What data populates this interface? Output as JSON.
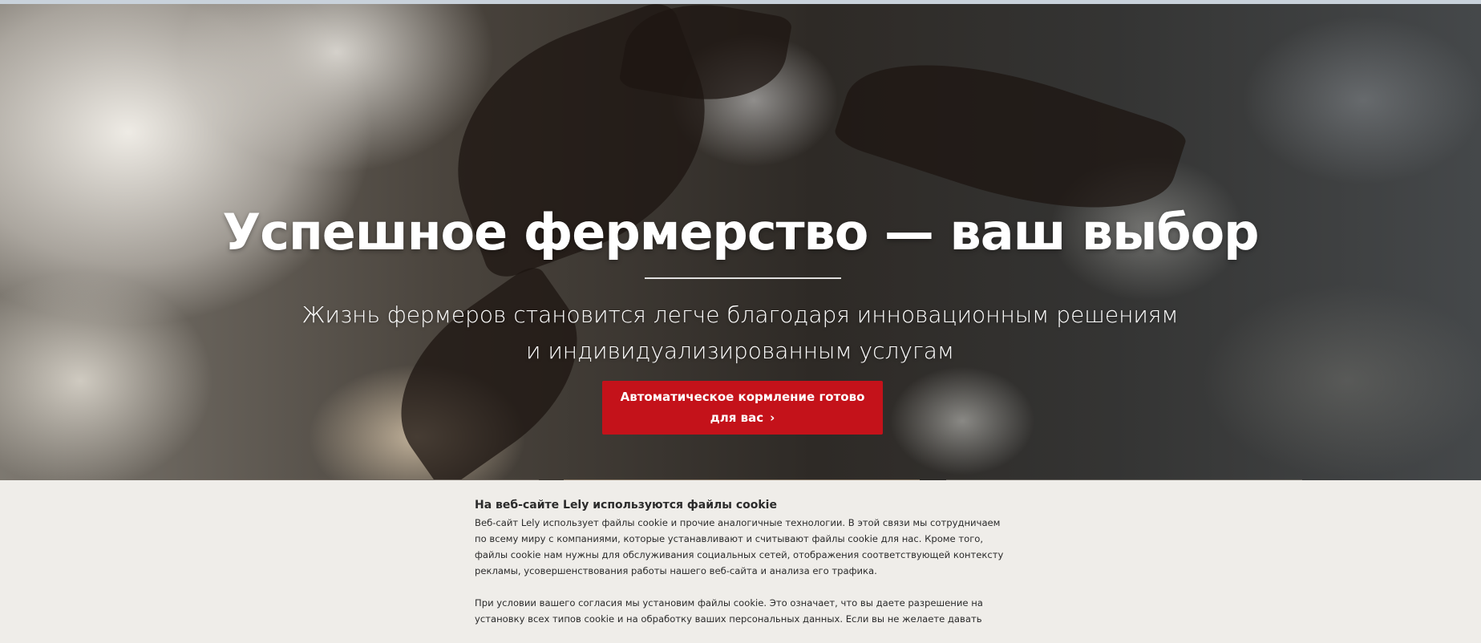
{
  "hero": {
    "title": "Успешное фермерство — ваш выбор",
    "subtitle": "Жизнь фермеров становится легче благодаря инновационным решениям и индивидуализированным услугам",
    "cta_label": "Автоматическое кормление готово для вас",
    "cta_icon": "chevron-right-icon"
  },
  "cookie_banner": {
    "title": "На веб-сайте Lely используются файлы cookie",
    "paragraph_1": "Веб-сайт Lely использует файлы cookie и прочие аналогичные технологии. В этой связи мы сотрудничаем по всему миру с компаниями, которые устанавливают и считывают файлы cookie для нас. Кроме того, файлы cookie нам нужны для обслуживания социальных сетей, отображения соответствующей контексту рекламы, усовершенствования работы нашего веб-сайта и анализа его трафика.",
    "paragraph_2": "При условии вашего согласия мы установим файлы cookie. Это означает, что вы даете разрешение на установку всех типов cookie и на обработку ваших персональных данных. Если вы не желаете давать"
  },
  "colors": {
    "cta_background": "#c4121a",
    "banner_background": "#efede9"
  }
}
